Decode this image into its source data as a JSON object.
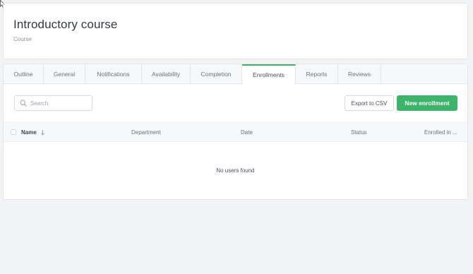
{
  "header": {
    "title": "Introductory course",
    "subtitle": "Course"
  },
  "tabs": [
    {
      "label": "Outline",
      "active": false
    },
    {
      "label": "General",
      "active": false
    },
    {
      "label": "Notifications",
      "active": false
    },
    {
      "label": "Availability",
      "active": false
    },
    {
      "label": "Completion",
      "active": false
    },
    {
      "label": "Enrollments",
      "active": true
    },
    {
      "label": "Reports",
      "active": false
    },
    {
      "label": "Reviews",
      "active": false
    }
  ],
  "toolbar": {
    "search_placeholder": "Search",
    "export_label": "Export to CSV",
    "new_label": "New enrollment"
  },
  "table": {
    "columns": [
      "Name",
      "Department",
      "Date",
      "Status",
      "Enrolled in ..."
    ],
    "empty_text": "No users found"
  },
  "colors": {
    "accent": "#3db36b",
    "background": "#f2f3f5"
  }
}
